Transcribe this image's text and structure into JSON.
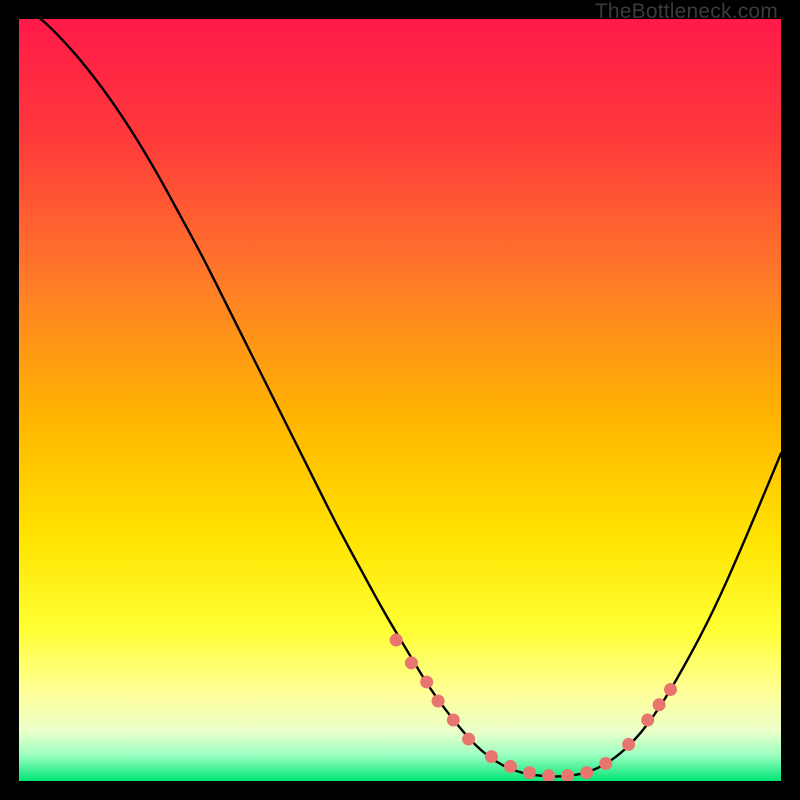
{
  "watermark": "TheBottleneck.com",
  "colors": {
    "gradient_top": "#ff1a4a",
    "gradient_mid1": "#ff6a2a",
    "gradient_mid2": "#ffd400",
    "gradient_low1": "#ffff66",
    "gradient_low2": "#f6ffb0",
    "gradient_bottom": "#00e676",
    "curve": "#000000",
    "dot": "#e8766f",
    "frame": "#000000"
  },
  "chart_data": {
    "type": "line",
    "title": "",
    "xlabel": "",
    "ylabel": "",
    "xlim": [
      0,
      100
    ],
    "ylim": [
      0,
      100
    ],
    "series": [
      {
        "name": "bottleneck-curve",
        "x": [
          0,
          3,
          6,
          9,
          12,
          15,
          18,
          21,
          24,
          27,
          30,
          33,
          36,
          39,
          42,
          45,
          48,
          51,
          54,
          57,
          60,
          63,
          66,
          69,
          72,
          75,
          78,
          81,
          84,
          87,
          91,
          95,
          100
        ],
        "y": [
          102,
          100,
          97,
          93.5,
          89.5,
          85,
          80,
          74.5,
          69,
          63,
          57,
          51,
          45,
          39,
          33,
          27.5,
          22,
          17,
          12,
          8,
          4.5,
          2.2,
          1,
          0.6,
          0.6,
          1.2,
          2.8,
          5.5,
          9.5,
          14.5,
          22,
          31,
          43
        ]
      }
    ],
    "dots": {
      "name": "sample-points",
      "x": [
        49.5,
        51.5,
        53.5,
        55,
        57,
        59,
        62,
        64.5,
        67,
        69.5,
        72,
        74.5,
        77,
        80,
        82.5,
        84,
        85.5
      ],
      "y": [
        18.5,
        15.5,
        13,
        10.5,
        8,
        5.5,
        3.2,
        1.9,
        1.1,
        0.7,
        0.7,
        1.1,
        2.3,
        4.8,
        8,
        10,
        12
      ]
    }
  }
}
